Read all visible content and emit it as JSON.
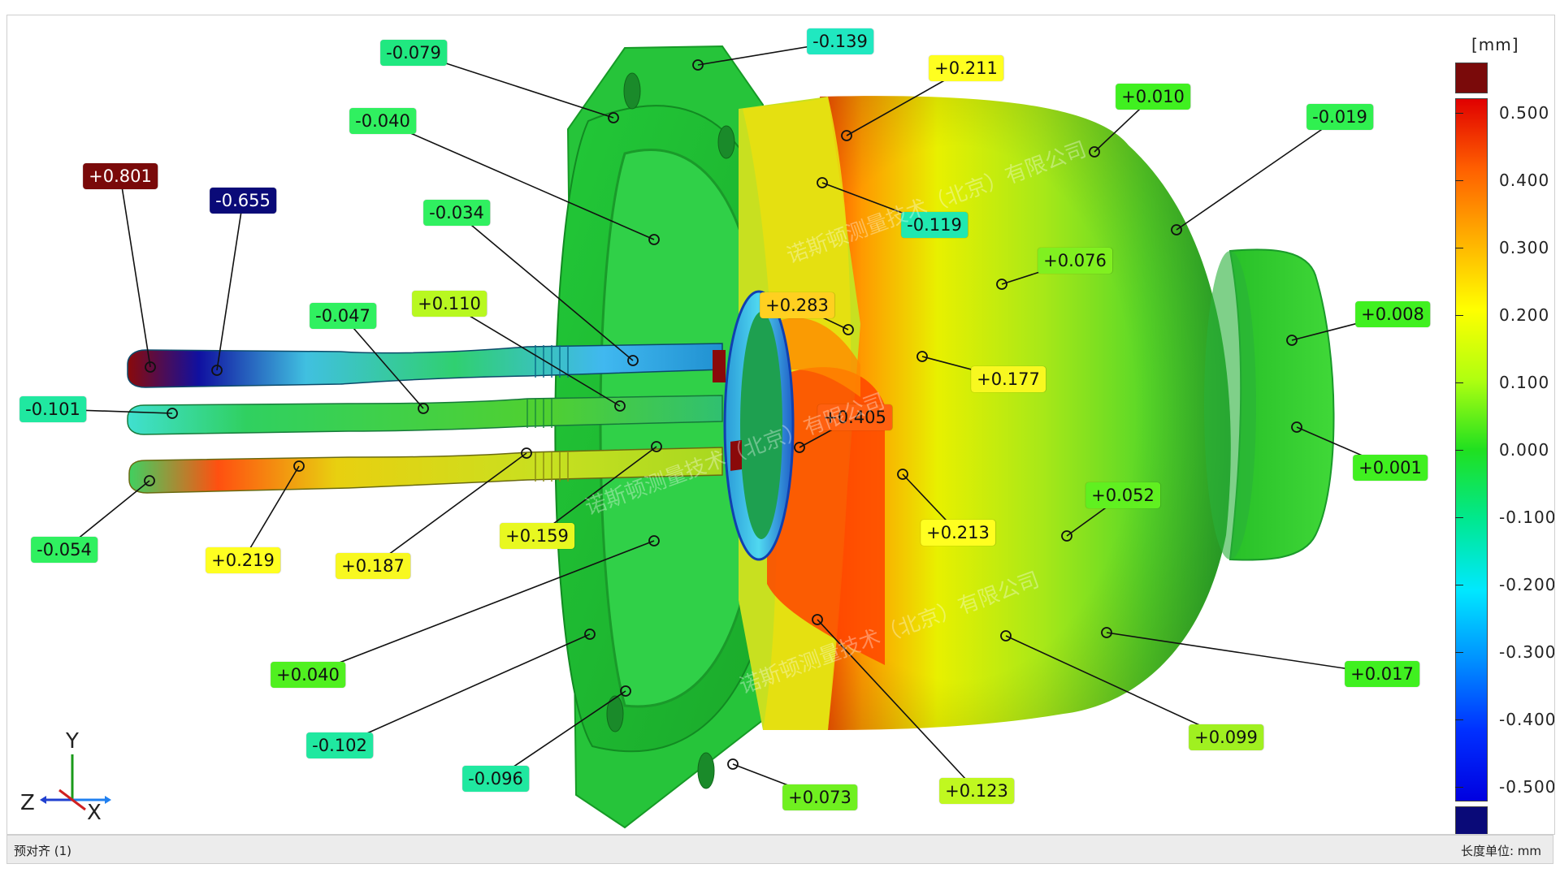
{
  "watermark": "诺斯顿测量技术（北京）有限公司",
  "scale": {
    "unit": "[mm]",
    "over_color": "#7a0a0a",
    "under_color": "#0a0a78",
    "ticks": [
      "0.500",
      "0.400",
      "0.300",
      "0.200",
      "0.100",
      "0.000",
      "-0.100",
      "-0.200",
      "-0.300",
      "-0.400",
      "-0.500"
    ],
    "gradient": [
      "#e00000",
      "#ff6000",
      "#ffb000",
      "#ffff00",
      "#b0ff10",
      "#20e020",
      "#00e890",
      "#00e8ff",
      "#0090ff",
      "#0030ff",
      "#0000e0"
    ]
  },
  "axes": {
    "y": "Y",
    "z": "Z",
    "x": "X"
  },
  "status": {
    "left": "预对齐 (1)",
    "right": "长度单位: mm"
  },
  "callouts": [
    {
      "id": "c-0139",
      "text": "-0.139",
      "color": "#20e8c0"
    },
    {
      "id": "c-0079",
      "text": "-0.079",
      "color": "#20e880"
    },
    {
      "id": "c-0211",
      "text": "+0.211",
      "color": "#ffff20"
    },
    {
      "id": "c-0010",
      "text": "+0.010",
      "color": "#40f020"
    },
    {
      "id": "c-0019",
      "text": "-0.019",
      "color": "#30f050"
    },
    {
      "id": "c-0040n",
      "text": "-0.040",
      "color": "#30f060"
    },
    {
      "id": "c-0801",
      "text": "+0.801",
      "color": "#7a0a0a",
      "dark": true
    },
    {
      "id": "c-0655",
      "text": "-0.655",
      "color": "#0a0a78",
      "dark": true
    },
    {
      "id": "c-0034",
      "text": "-0.034",
      "color": "#30f060"
    },
    {
      "id": "c-0119",
      "text": "-0.119",
      "color": "#20e8b0"
    },
    {
      "id": "c-0076",
      "text": "+0.076",
      "color": "#80f020"
    },
    {
      "id": "c-0047",
      "text": "-0.047",
      "color": "#30f060"
    },
    {
      "id": "c-0110",
      "text": "+0.110",
      "color": "#b8f820"
    },
    {
      "id": "c-0283",
      "text": "+0.283",
      "color": "#ffd020"
    },
    {
      "id": "c-0008",
      "text": "+0.008",
      "color": "#40f020"
    },
    {
      "id": "c-0101",
      "text": "-0.101",
      "color": "#20e8a0"
    },
    {
      "id": "c-0177",
      "text": "+0.177",
      "color": "#f8f820"
    },
    {
      "id": "c-0405",
      "text": "+0.405",
      "color": "#ff6010"
    },
    {
      "id": "c-0001",
      "text": "+0.001",
      "color": "#40f020"
    },
    {
      "id": "c-0052",
      "text": "+0.052",
      "color": "#60f020"
    },
    {
      "id": "c-0159",
      "text": "+0.159",
      "color": "#e8f820"
    },
    {
      "id": "c-0213",
      "text": "+0.213",
      "color": "#ffff20"
    },
    {
      "id": "c-0054",
      "text": "-0.054",
      "color": "#30f060"
    },
    {
      "id": "c-0219",
      "text": "+0.219",
      "color": "#ffff20"
    },
    {
      "id": "c-0187",
      "text": "+0.187",
      "color": "#f8f820"
    },
    {
      "id": "c-0040p",
      "text": "+0.040",
      "color": "#50f020"
    },
    {
      "id": "c-0017",
      "text": "+0.017",
      "color": "#40f020"
    },
    {
      "id": "c-0102",
      "text": "-0.102",
      "color": "#20e8a0"
    },
    {
      "id": "c-0099",
      "text": "+0.099",
      "color": "#a0f020"
    },
    {
      "id": "c-0096",
      "text": "-0.096",
      "color": "#20e8a0"
    },
    {
      "id": "c-0073",
      "text": "+0.073",
      "color": "#70f020"
    },
    {
      "id": "c-0123",
      "text": "+0.123",
      "color": "#c0f820"
    }
  ]
}
